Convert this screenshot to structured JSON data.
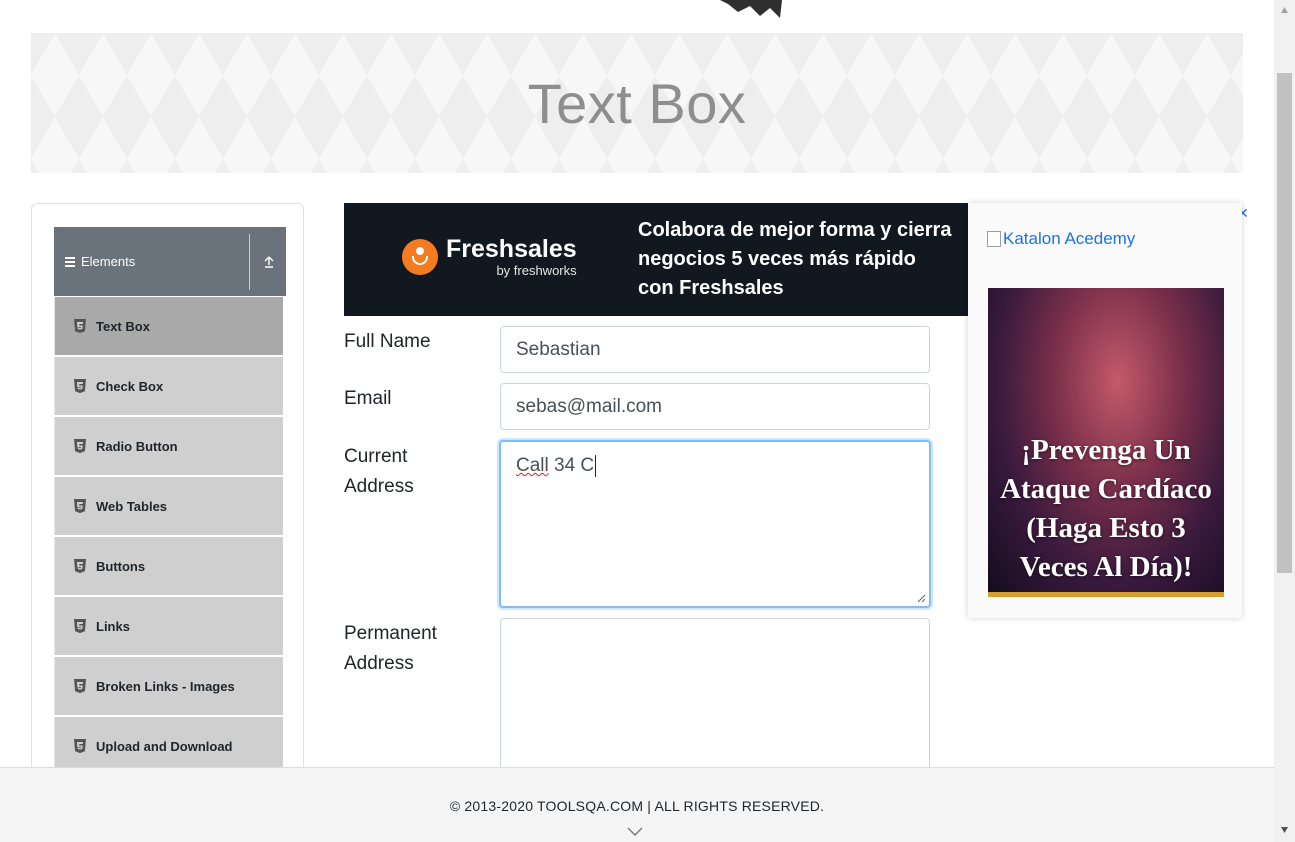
{
  "page": {
    "title": "Text Box"
  },
  "sidebar": {
    "group_label": "Elements",
    "items": [
      {
        "label": "Text Box",
        "active": true
      },
      {
        "label": "Check Box"
      },
      {
        "label": "Radio Button"
      },
      {
        "label": "Web Tables"
      },
      {
        "label": "Buttons"
      },
      {
        "label": "Links"
      },
      {
        "label": "Broken Links - Images"
      },
      {
        "label": "Upload and Download"
      }
    ]
  },
  "ad_top": {
    "brand": "Freshsales",
    "brand_sub": "by freshworks",
    "line1": "Colabora de mejor forma y cierra",
    "line2": "negocios 5 veces más rápido",
    "line3": "con Freshsales"
  },
  "form": {
    "full_name_label": "Full Name",
    "full_name_value": "Sebastian",
    "email_label": "Email",
    "email_value": "sebas@mail.com",
    "current_address_label_1": "Current",
    "current_address_label_2": "Address",
    "current_address_word1": "Call",
    "current_address_rest": " 34 C",
    "permanent_address_label_1": "Permanent",
    "permanent_address_label_2": "Address",
    "permanent_address_value": ""
  },
  "ad_side": {
    "link_alt": "Katalon Acedemy",
    "headline": "¡Prevenga Un Ataque Cardíaco (Haga Esto 3 Veces Al Día)!"
  },
  "footer": {
    "copyright": "© 2013-2020 TOOLSQA.COM | ALL RIGHTS RESERVED."
  },
  "colors": {
    "sidebar_header": "#6a737c",
    "menu_item": "#cfcfcf",
    "menu_item_active": "#a9a9a9",
    "focus_border": "#80bdff",
    "freshsales_orange": "#f47b20"
  },
  "icons": {
    "menu": "hamburger-icon",
    "collapse": "arrow-up-icon",
    "item": "html5-icon",
    "footer": "chevron-down-icon"
  }
}
